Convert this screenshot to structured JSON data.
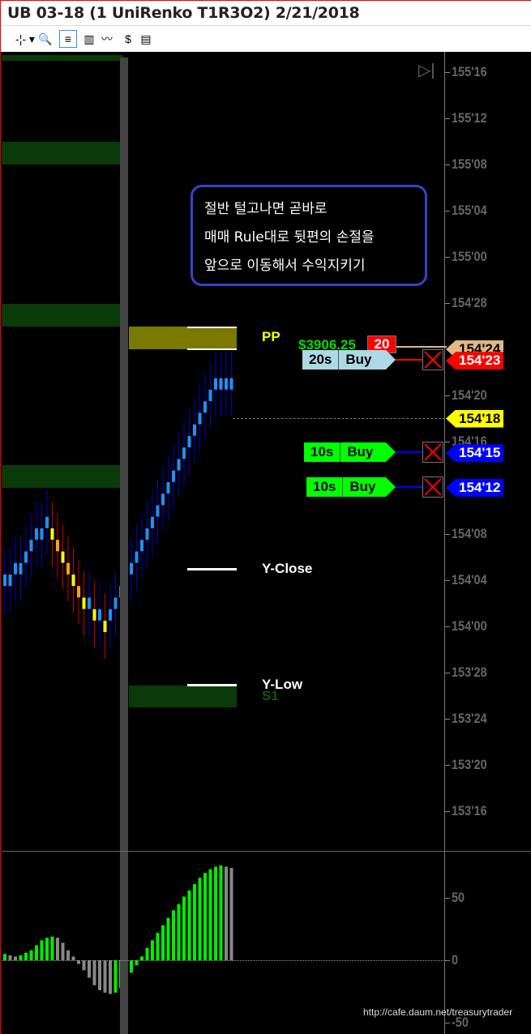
{
  "window": {
    "title": "UB 03-18 (1 UniRenko T1R3O2)  2/21/2018"
  },
  "toolbar": {
    "items": [
      {
        "name": "crosshair-icon",
        "glyph": "-¦- ▾"
      },
      {
        "name": "zoom-icon",
        "glyph": "🔍"
      },
      {
        "name": "chart-trader-icon",
        "glyph": "≡",
        "selected": true
      },
      {
        "name": "bar-style-icon",
        "glyph": "▥"
      },
      {
        "name": "indicators-icon",
        "glyph": "〰"
      },
      {
        "name": "strategies-icon",
        "glyph": "$"
      },
      {
        "name": "properties-icon",
        "glyph": "▤"
      }
    ]
  },
  "price_axis": {
    "labels": [
      "155'16",
      "155'12",
      "155'08",
      "155'04",
      "155'00",
      "154'28",
      "154'20",
      "154'16",
      "154'08",
      "154'04",
      "154'00",
      "153'28",
      "153'24",
      "153'20",
      "153'16"
    ]
  },
  "price_markers": [
    {
      "label": "154'24",
      "bg": "#deb887",
      "fg": "#000"
    },
    {
      "label": "154'23",
      "bg": "#ff0000",
      "fg": "#fff"
    },
    {
      "label": "154'18",
      "bg": "#ffff00",
      "fg": "#000"
    },
    {
      "label": "154'15",
      "bg": "#0000ff",
      "fg": "#fff"
    },
    {
      "label": "154'12",
      "bg": "#0000ff",
      "fg": "#fff"
    }
  ],
  "orders": [
    {
      "qty": "20s",
      "name": "Buy S2",
      "bg": "#add8e6",
      "line": "#ff0000"
    },
    {
      "qty": "10s",
      "name": "Buy T2",
      "bg": "#00ff00",
      "line": "#0000ff"
    },
    {
      "qty": "10s",
      "name": "Buy T1",
      "bg": "#00ff00",
      "line": "#0000ff"
    }
  ],
  "position": {
    "pnl": "$3906.25",
    "qty": "20"
  },
  "levels": {
    "pp": "PP",
    "y_close": "Y-Close",
    "y_low": "Y-Low",
    "s1": "S1"
  },
  "annotation": {
    "lines": [
      "절반 털고나면 곧바로",
      "매매 Rule대로 뒷편의 손절을",
      "앞으로 이동해서 수익지키기"
    ]
  },
  "oscillator_axis": {
    "labels": [
      "50",
      "0",
      "-50"
    ]
  },
  "watermark": "http://cafe.daum.net/treasurytrader",
  "chart_data": {
    "type": "bar",
    "price_bars_close": [
      "154'04",
      "154'04",
      "154'05",
      "154'05",
      "154'06",
      "154'07",
      "154'08",
      "154'08",
      "154'09",
      "154'08",
      "154'07",
      "154'06",
      "154'05",
      "154'04",
      "154'03",
      "154'02",
      "154'02",
      "154'01",
      "154'01",
      "154'00",
      "154'01",
      "154'02",
      "154'03",
      "154'04",
      "154'05",
      "154'06",
      "154'07",
      "154'08",
      "154'09",
      "154'10",
      "154'11",
      "154'12",
      "154'13",
      "154'14",
      "154'15",
      "154'16",
      "154'17",
      "154'18",
      "154'19",
      "154'20",
      "154'21",
      "154'21",
      "154'21",
      "154'21"
    ],
    "oscillator": [
      5,
      4,
      3,
      4,
      6,
      8,
      12,
      16,
      18,
      19,
      18,
      14,
      8,
      3,
      -3,
      -8,
      -14,
      -20,
      -24,
      -26,
      -27,
      -26,
      -22,
      -17,
      -10,
      -4,
      3,
      10,
      16,
      22,
      28,
      34,
      40,
      45,
      51,
      56,
      61,
      66,
      70,
      73,
      75,
      76,
      75,
      74
    ],
    "colors": {
      "up": "#1e90ff",
      "down": "#ffa500",
      "osc_up": "#00ee00",
      "osc_down": "#888888"
    }
  }
}
